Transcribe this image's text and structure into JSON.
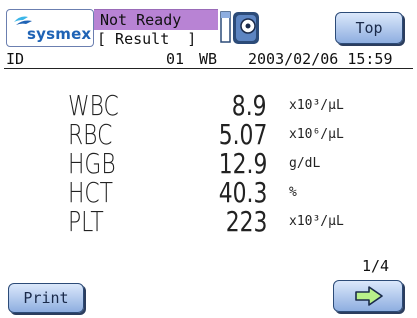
{
  "header": {
    "brand": "sysmex",
    "status": "Not Ready",
    "mode_label": "[ Result  ]",
    "top_button": "Top"
  },
  "info": {
    "id_label": "ID",
    "id_value": "01",
    "mode": "WB",
    "datetime": "2003/02/06 15:59"
  },
  "results": [
    {
      "name": "WBC",
      "value": "8.9",
      "unit": "x10³/µL"
    },
    {
      "name": "RBC",
      "value": "5.07",
      "unit": "x10⁶/µL"
    },
    {
      "name": "HGB",
      "value": "12.9",
      "unit": "g/dL"
    },
    {
      "name": "HCT",
      "value": "40.3",
      "unit": "%"
    },
    {
      "name": "PLT",
      "value": "223",
      "unit": "x10³/µL"
    }
  ],
  "footer": {
    "page": "1/4",
    "print_button": "Print",
    "next_icon": "arrow-right-icon"
  },
  "colors": {
    "status_bar": "#b883d4",
    "button_top": "#dbe8fb",
    "button_bottom": "#8eaee0",
    "brand": "#1f63b5"
  }
}
